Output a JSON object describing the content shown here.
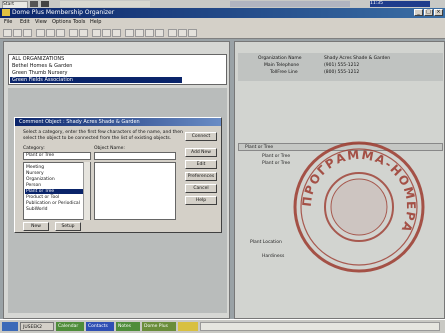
{
  "top_strip": {
    "start_label": "Start",
    "clock": "11:35"
  },
  "window": {
    "title": "Dome Plus Membership Organizer"
  },
  "menu": {
    "items": [
      "File",
      "Edit",
      "View",
      "Options",
      "Tools",
      "Help"
    ]
  },
  "organizations": {
    "header": "ALL ORGANIZATIONS",
    "items": [
      "Bethel Homes & Garden",
      "Green Thumb Nursery",
      "Green Fields Association"
    ],
    "selected_index": 2
  },
  "dialog": {
    "title": "Comment Object : Shady Acres Shade & Garden",
    "instructions": "Select a category, enter the first few characters of the name, and then select the object to be connected from the list of existing objects.",
    "category_label": "Category:",
    "object_name_label": "Object Name:",
    "category_value": "Plant or Tree",
    "categories": [
      "Meeting",
      "Nursery",
      "Organization",
      "Person",
      "Plant or Tree",
      "Product or Tool",
      "Publication or Periodical",
      "SubWorld"
    ],
    "selected_category_index": 4,
    "buttons": {
      "connect": "Connect",
      "add_new": "Add New",
      "edit": "Edit",
      "preferences": "Preferences",
      "cancel": "Cancel",
      "help": "Help",
      "new": "New",
      "setup": "Setup"
    }
  },
  "details": {
    "org_name_label": "Organization Name",
    "org_name_value": "Shady Acres Shade & Garden",
    "main_phone_label": "Main Telephone",
    "main_phone_value": "(901) 555-1212",
    "toll_free_label": "TollFree Line",
    "toll_free_value": "(800) 555-1212",
    "section_tab": "Plant or Tree",
    "plant_labels": [
      "Plant or Tree",
      "Plant or Tree"
    ],
    "bottom_labels": [
      "Plant Location",
      "Hardiness"
    ]
  },
  "stamp": {
    "text": "ПРОГРАММА-НОМЕРА"
  },
  "taskbar": {
    "items": [
      "JUSEEK2",
      "Calendar",
      "Contacts",
      "Notes",
      "Dome Plus"
    ]
  },
  "colors": {
    "titlebar": "#0a246a",
    "selection": "#0a246a",
    "stamp": "#9c3a2e",
    "taskbar_green": "#4f8d3a",
    "taskbar_blue": "#2f4fb4"
  }
}
